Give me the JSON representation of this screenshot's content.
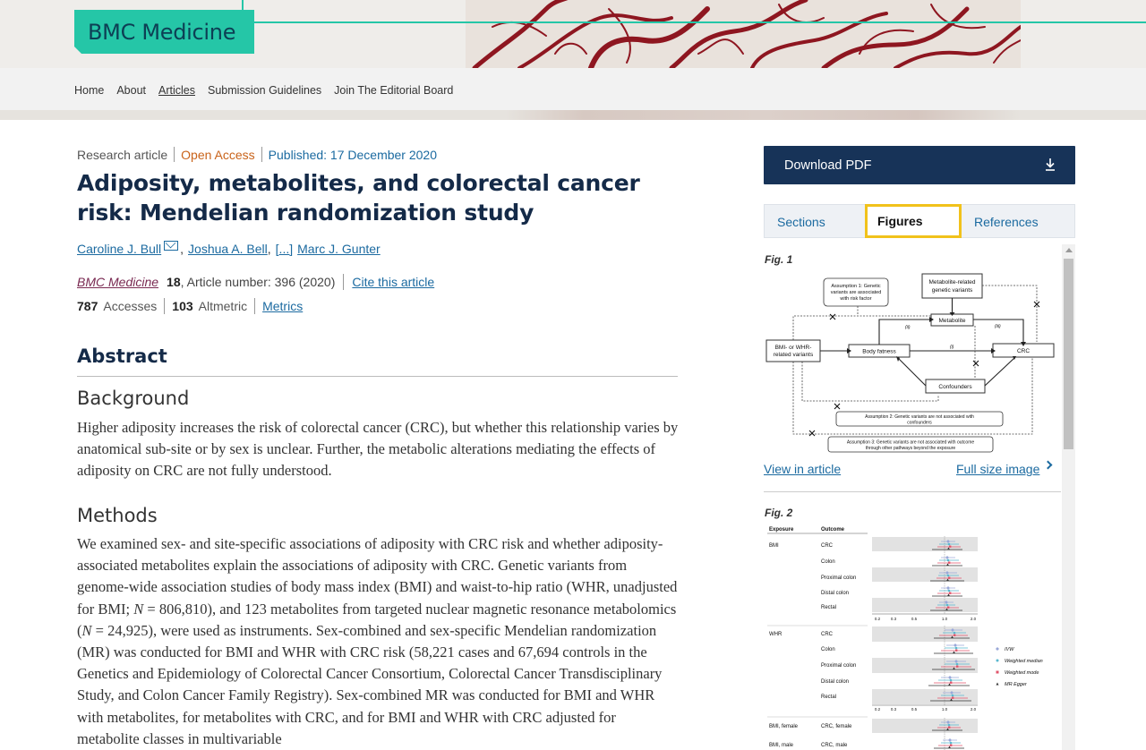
{
  "header": {
    "logo_text": "BMC Medicine",
    "brand_color": "#25c6a7",
    "nav": [
      "Home",
      "About",
      "Articles",
      "Submission Guidelines",
      "Join The Editorial Board"
    ],
    "active_nav": "Articles"
  },
  "article": {
    "type": "Research article",
    "access": "Open Access",
    "published": "Published: 17 December 2020",
    "title": "Adiposity, metabolites, and colorectal cancer risk: Mendelian randomization study",
    "authors": [
      "Caroline J. Bull",
      "Joshua A. Bell",
      "[...]",
      "Marc J. Gunter"
    ],
    "journal": "BMC Medicine",
    "volume": "18",
    "article_number": ", Article number: 396 (2020)",
    "cite": "Cite this article",
    "accesses_count": "787",
    "accesses_label": "Accesses",
    "altmetric_count": "103",
    "altmetric_label": "Altmetric",
    "metrics_link": "Metrics"
  },
  "abstract": {
    "heading": "Abstract",
    "background_heading": "Background",
    "background_text": "Higher adiposity increases the risk of colorectal cancer (CRC), but whether this relationship varies by anatomical sub-site or by sex is unclear. Further, the metabolic alterations mediating the effects of adiposity on CRC are not fully understood.",
    "methods_heading": "Methods",
    "methods_p1": "We examined sex- and site-specific associations of adiposity with CRC risk and whether adiposity-associated metabolites explain the associations of adiposity with CRC. Genetic variants from genome-wide association studies of body mass index (BMI) and waist-to-hip ratio (WHR, unadjusted for BMI; ",
    "methods_n1_var": "N",
    "methods_n1_val": " = 806,810), and 123 metabolites from targeted nuclear magnetic resonance metabolomics (",
    "methods_n2_var": "N",
    "methods_n2_val": " = 24,925), were used as instruments. Sex-combined and sex-specific Mendelian randomization (MR) was conducted for BMI and WHR with CRC risk (58,221 cases and 67,694 controls in the Genetics and Epidemiology of Colorectal Cancer Consortium, Colorectal Cancer Transdisciplinary Study, and Colon Cancer Family Registry). Sex-combined MR was conducted for BMI and WHR with metabolites, for metabolites with CRC, and for BMI and WHR with CRC adjusted for metabolite classes in multivariable"
  },
  "sidebar": {
    "download": "Download PDF",
    "tabs": [
      "Sections",
      "Figures",
      "References"
    ],
    "active_tab": "Figures",
    "fig1": {
      "label": "Fig. 1",
      "view_link": "View in article",
      "full_link": "Full size image",
      "diagram": {
        "assumption1": [
          "Assumption 1: Genetic",
          "variants are associated",
          "with risk factor"
        ],
        "metabolite_variants": [
          "Metabolite-related",
          "genetic variants"
        ],
        "metabolite": "Metabolite",
        "exposure_variants": [
          "BMI- or WHR-",
          "related variants"
        ],
        "body_fatness": "Body fatness",
        "crc": "CRC",
        "confounders": "Confounders",
        "path_ii": "(ii)",
        "path_i": "(i)",
        "path_iii": "(iii)",
        "assumption2": [
          "Assumption 2: Genetic variants are not associated with",
          "confounders"
        ],
        "assumption3": [
          "Assumption 3: Genetic variants are not associated with outcome",
          "through other pathways beyond the exposure"
        ]
      }
    },
    "fig2": {
      "label": "Fig. 2",
      "col_exposure": "Exposure",
      "col_outcome": "Outcome",
      "groups": [
        {
          "exposure": "BMI",
          "outcomes": [
            "CRC",
            "Colon",
            "Proximal colon",
            "Distal colon",
            "Rectal"
          ]
        },
        {
          "exposure": "WHR",
          "outcomes": [
            "CRC",
            "Colon",
            "Proximal colon",
            "Distal colon",
            "Rectal"
          ]
        }
      ],
      "sex_rows": [
        {
          "exposure": "BMI, female",
          "outcome": "CRC, female"
        },
        {
          "exposure": "BMI, male",
          "outcome": "CRC, male"
        }
      ],
      "ticks": [
        "0.2",
        "0.3",
        "0.5",
        "1.0",
        "2.0"
      ],
      "legend": [
        {
          "name": "IVW",
          "color": "#9aa8d8"
        },
        {
          "name": "Weighted median",
          "color": "#59b8cf"
        },
        {
          "name": "Weighted mode",
          "color": "#e0556b"
        },
        {
          "name": "MR Egger",
          "color": "#333333"
        }
      ]
    }
  }
}
